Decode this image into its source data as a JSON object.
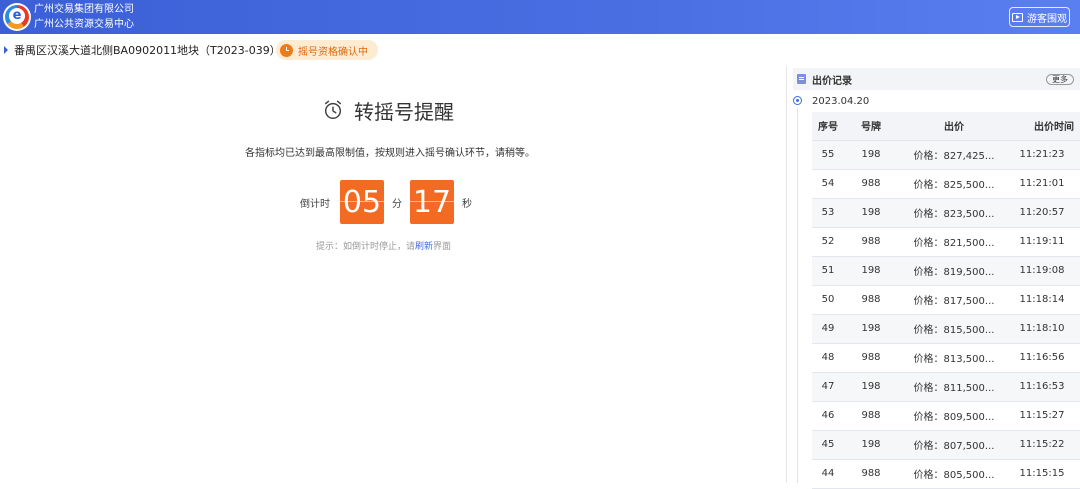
{
  "header": {
    "org_line1": "广州交易集团有限公司",
    "org_line2": "广州公共资源交易中心",
    "tour_button": "游客围观",
    "brand_colors": {
      "header_blue": "#4a6fe3",
      "accent_orange": "#f36b22"
    }
  },
  "lot": {
    "title": "番禺区汉溪大道北侧BA0902011地块（T2023-039）",
    "status": "摇号资格确认中"
  },
  "notice": {
    "title": "转摇号提醒",
    "description": "各指标均已达到最高限制值，按规则进入摇号确认环节，请稍等。",
    "countdown_label": "倒计时",
    "minutes": "05",
    "minutes_unit": "分",
    "seconds": "17",
    "seconds_unit": "秒",
    "hint_prefix": "提示：如倒计时停止，请",
    "hint_link": "刷新",
    "hint_suffix": "界面"
  },
  "bids": {
    "panel_title": "出价记录",
    "more_button": "更多",
    "date": "2023.04.20",
    "columns": [
      "序号",
      "号牌",
      "出价",
      "出价时间"
    ],
    "rows": [
      {
        "seq": "55",
        "plate": "198",
        "price": "价格：827,425...",
        "time": "11:21:23"
      },
      {
        "seq": "54",
        "plate": "988",
        "price": "价格：825,500...",
        "time": "11:21:01"
      },
      {
        "seq": "53",
        "plate": "198",
        "price": "价格：823,500...",
        "time": "11:20:57"
      },
      {
        "seq": "52",
        "plate": "988",
        "price": "价格：821,500...",
        "time": "11:19:11"
      },
      {
        "seq": "51",
        "plate": "198",
        "price": "价格：819,500...",
        "time": "11:19:08"
      },
      {
        "seq": "50",
        "plate": "988",
        "price": "价格：817,500...",
        "time": "11:18:14"
      },
      {
        "seq": "49",
        "plate": "198",
        "price": "价格：815,500...",
        "time": "11:18:10"
      },
      {
        "seq": "48",
        "plate": "988",
        "price": "价格：813,500...",
        "time": "11:16:56"
      },
      {
        "seq": "47",
        "plate": "198",
        "price": "价格：811,500...",
        "time": "11:16:53"
      },
      {
        "seq": "46",
        "plate": "988",
        "price": "价格：809,500...",
        "time": "11:15:27"
      },
      {
        "seq": "45",
        "plate": "198",
        "price": "价格：807,500...",
        "time": "11:15:22"
      },
      {
        "seq": "44",
        "plate": "988",
        "price": "价格：805,500...",
        "time": "11:15:15"
      }
    ]
  }
}
